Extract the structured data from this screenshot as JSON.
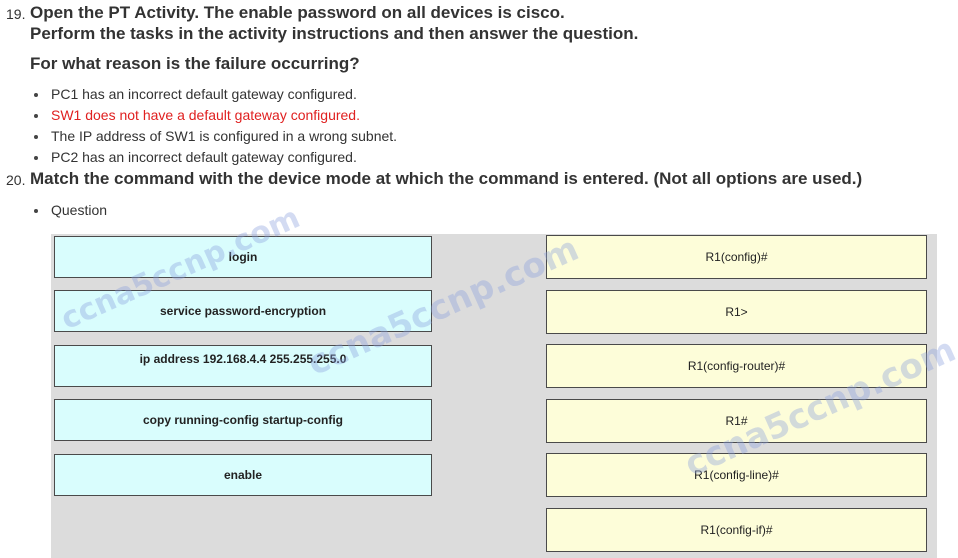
{
  "q19": {
    "number": "19.",
    "line1": "Open the PT Activity. The enable password on all devices is cisco.",
    "line2": "Perform the tasks in the activity instructions and then answer the question.",
    "prompt": "For what reason is the failure occurring?",
    "options": [
      {
        "text": "PC1 has an incorrect default gateway configured.",
        "correct": false
      },
      {
        "text": "SW1 does not have a default gateway configured.",
        "correct": true
      },
      {
        "text": "The IP address of SW1 is configured in a wrong subnet.",
        "correct": false
      },
      {
        "text": "PC2 has an incorrect default gateway configured.",
        "correct": false
      }
    ]
  },
  "q20": {
    "number": "20.",
    "text": "Match the command with the device mode at which the command is entered. (Not all options are used.)",
    "bullet": "Question",
    "commands": [
      "login",
      "service password-encryption",
      "ip address 192.168.4.4 255.255.255.0",
      "copy running-config startup-config",
      "enable"
    ],
    "modes": [
      "R1(config)#",
      "R1>",
      "R1(config-router)#",
      "R1#",
      "R1(config-line)#",
      "R1(config-if)#"
    ]
  },
  "watermark": "ccna5ccnp.com",
  "colors": {
    "command_fill": "#d9fdfd",
    "mode_fill": "#fdfdd9",
    "board_bg": "#dcdcdc",
    "correct_text": "#e02020"
  }
}
